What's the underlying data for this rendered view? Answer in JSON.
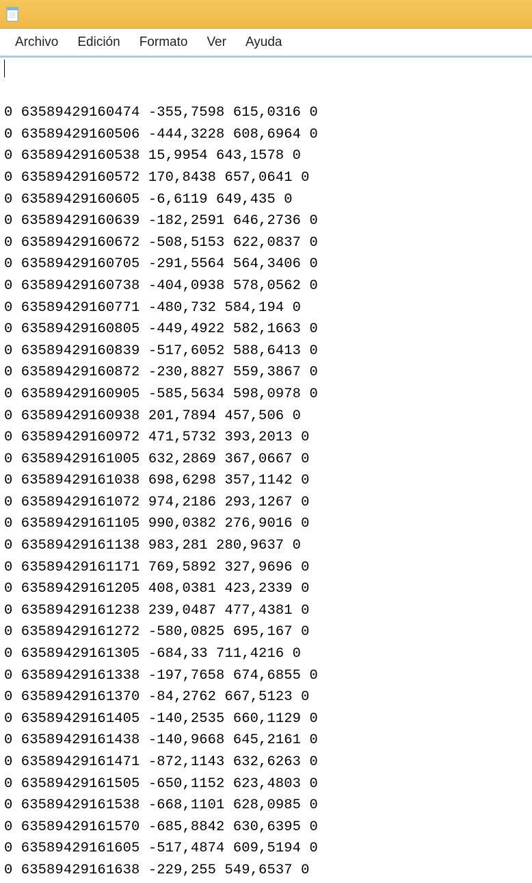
{
  "menu": {
    "archivo": "Archivo",
    "edicion": "Edición",
    "formato": "Formato",
    "ver": "Ver",
    "ayuda": "Ayuda"
  },
  "lines": [
    "0 63589429160474 -355,7598 615,0316 0",
    "0 63589429160506 -444,3228 608,6964 0",
    "0 63589429160538 15,9954 643,1578 0",
    "0 63589429160572 170,8438 657,0641 0",
    "0 63589429160605 -6,6119 649,435 0",
    "0 63589429160639 -182,2591 646,2736 0",
    "0 63589429160672 -508,5153 622,0837 0",
    "0 63589429160705 -291,5564 564,3406 0",
    "0 63589429160738 -404,0938 578,0562 0",
    "0 63589429160771 -480,732 584,194 0",
    "0 63589429160805 -449,4922 582,1663 0",
    "0 63589429160839 -517,6052 588,6413 0",
    "0 63589429160872 -230,8827 559,3867 0",
    "0 63589429160905 -585,5634 598,0978 0",
    "0 63589429160938 201,7894 457,506 0",
    "0 63589429160972 471,5732 393,2013 0",
    "0 63589429161005 632,2869 367,0667 0",
    "0 63589429161038 698,6298 357,1142 0",
    "0 63589429161072 974,2186 293,1267 0",
    "0 63589429161105 990,0382 276,9016 0",
    "0 63589429161138 983,281 280,9637 0",
    "0 63589429161171 769,5892 327,9696 0",
    "0 63589429161205 408,0381 423,2339 0",
    "0 63589429161238 239,0487 477,4381 0",
    "0 63589429161272 -580,0825 695,167 0",
    "0 63589429161305 -684,33 711,4216 0",
    "0 63589429161338 -197,7658 674,6855 0",
    "0 63589429161370 -84,2762 667,5123 0",
    "0 63589429161405 -140,2535 660,1129 0",
    "0 63589429161438 -140,9668 645,2161 0",
    "0 63589429161471 -872,1143 632,6263 0",
    "0 63589429161505 -650,1152 623,4803 0",
    "0 63589429161538 -668,1101 628,0985 0",
    "0 63589429161570 -685,8842 630,6395 0",
    "0 63589429161605 -517,4874 609,5194 0",
    "0 63589429161638 -229,255 549,6537 0"
  ]
}
